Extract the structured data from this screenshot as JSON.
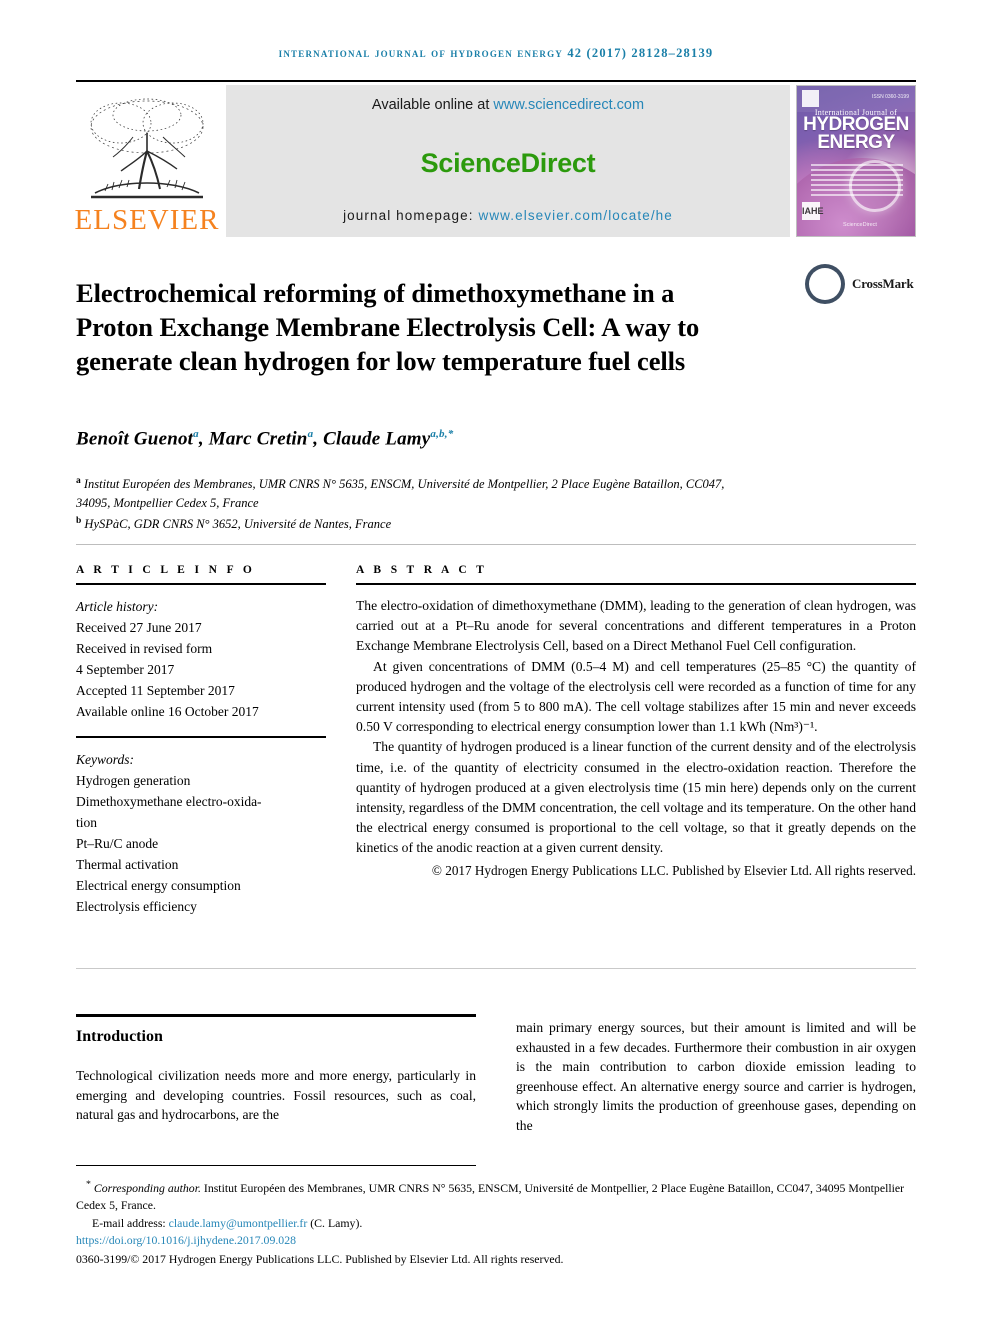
{
  "running_head": "INTERNATIONAL JOURNAL OF HYDROGEN ENERGY 42 (2017) 28128–28139",
  "masthead": {
    "publisher": "ELSEVIER",
    "available_text": "Available online at ",
    "sciencedirect_url": "www.sciencedirect.com",
    "sciencedirect_logo": "ScienceDirect",
    "homepage_label": "journal homepage: ",
    "homepage_url": "www.elsevier.com/locate/he",
    "cover": {
      "line1": "International Journal of",
      "line2": "HYDROGEN",
      "line3": "ENERGY",
      "issn": "ISSN 0360-3199",
      "footer": "ScienceDirect",
      "badge": "IAHE"
    },
    "colors": {
      "elsevier_orange": "#f5821f",
      "sciencedirect_green": "#2c9a0d",
      "link_blue": "#2787b8",
      "banner_gray": "#e4e4e4",
      "header_blue": "#1a7fa8"
    }
  },
  "article": {
    "title": "Electrochemical reforming of dimethoxymethane in a Proton Exchange Membrane Electrolysis Cell: A way to generate clean hydrogen for low temperature fuel cells",
    "crossmark_label": "CrossMark",
    "authors": [
      {
        "name": "Benoît Guenot",
        "sup": "a"
      },
      {
        "name": "Marc Cretin",
        "sup": "a"
      },
      {
        "name": "Claude Lamy",
        "sup": "a,b,*"
      }
    ],
    "affiliations": [
      {
        "marker": "a",
        "text": "Institut Européen des Membranes, UMR CNRS N° 5635, ENSCM, Université de Montpellier, 2 Place Eugène Bataillon, CC047, 34095, Montpellier Cedex 5, France"
      },
      {
        "marker": "b",
        "text": "HySPàC, GDR CNRS N° 3652, Université de Nantes, France"
      }
    ]
  },
  "article_info": {
    "label": "A R T I C L E  I N F O",
    "history_heading": "Article history:",
    "history": [
      "Received 27 June 2017",
      "Received in revised form",
      "4 September 2017",
      "Accepted 11 September 2017",
      "Available online 16 October 2017"
    ],
    "keywords_heading": "Keywords:",
    "keywords": [
      "Hydrogen generation",
      "Dimethoxymethane electro-oxida-",
      "tion",
      "Pt–Ru/C anode",
      "Thermal activation",
      "Electrical energy consumption",
      "Electrolysis efficiency"
    ]
  },
  "abstract": {
    "label": "A B S T R A C T",
    "paragraphs": [
      "The electro-oxidation of dimethoxymethane (DMM), leading to the generation of clean hydrogen, was carried out at a Pt–Ru anode for several concentrations and different temperatures in a Proton Exchange Membrane Electrolysis Cell, based on a Direct Methanol Fuel Cell configuration.",
      "At given concentrations of DMM (0.5–4 M) and cell temperatures (25–85 °C) the quantity of produced hydrogen and the voltage of the electrolysis cell were recorded as a function of time for any current intensity used (from 5 to 800 mA). The cell voltage stabilizes after 15 min and never exceeds 0.50 V corresponding to electrical energy consumption lower than 1.1 kWh (Nm³)⁻¹.",
      "The quantity of hydrogen produced is a linear function of the current density and of the electrolysis time, i.e. of the quantity of electricity consumed in the electro-oxidation reaction. Therefore the quantity of hydrogen produced at a given electrolysis time (15 min here) depends only on the current intensity, regardless of the DMM concentration, the cell voltage and its temperature. On the other hand the electrical energy consumed is proportional to the cell voltage, so that it greatly depends on the kinetics of the anodic reaction at a given current density."
    ],
    "copyright": "© 2017 Hydrogen Energy Publications LLC. Published by Elsevier Ltd. All rights reserved."
  },
  "body": {
    "section_heading": "Introduction",
    "left_column": "Technological civilization needs more and more energy, particularly in emerging and developing countries. Fossil resources, such as coal, natural gas and hydrocarbons, are the",
    "right_column": "main primary energy sources, but their amount is limited and will be exhausted in a few decades. Furthermore their combustion in air oxygen is the main contribution to carbon dioxide emission leading to greenhouse effect. An alternative energy source and carrier is hydrogen, which strongly limits the production of greenhouse gases, depending on the"
  },
  "footer": {
    "corresponding_marker": "*",
    "corresponding_label": "Corresponding author.",
    "corresponding_address": " Institut Européen des Membranes, UMR CNRS N° 5635, ENSCM, Université de Montpellier, 2 Place Eugène Bataillon, CC047, 34095 Montpellier Cedex 5, France.",
    "email_label": "E-mail address: ",
    "email": "claude.lamy@umontpellier.fr",
    "email_suffix": " (C. Lamy).",
    "doi": "https://doi.org/10.1016/j.ijhydene.2017.09.028",
    "issn_line": "0360-3199/© 2017 Hydrogen Energy Publications LLC. Published by Elsevier Ltd. All rights reserved."
  }
}
